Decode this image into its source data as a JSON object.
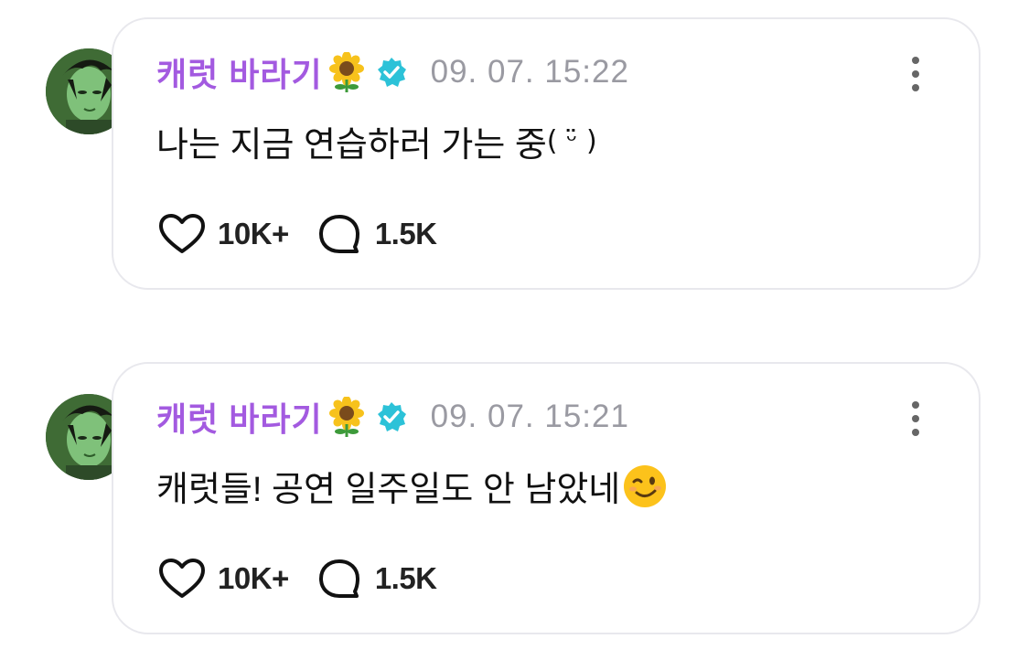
{
  "colors": {
    "name": "#a35ae0",
    "verified": "#2cc2d8",
    "time": "#9a9aa2",
    "border": "#e8e8ed"
  },
  "posts": [
    {
      "author": "캐럿 바라기",
      "author_emoji": "sunflower-icon",
      "verified": "verified-badge-icon",
      "timestamp": "09. 07. 15:22",
      "text": "나는 지금 연습하러 가는 중",
      "text_suffix": "( ᵕ̈ )",
      "likes": "10K+",
      "comments": "1.5K"
    },
    {
      "author": "캐럿 바라기",
      "author_emoji": "sunflower-icon",
      "verified": "verified-badge-icon",
      "timestamp": "09. 07. 15:21",
      "text": "캐럿들! 공연 일주일도 안 남았네",
      "text_emoji": "winking-face-icon",
      "likes": "10K+",
      "comments": "1.5K"
    }
  ]
}
